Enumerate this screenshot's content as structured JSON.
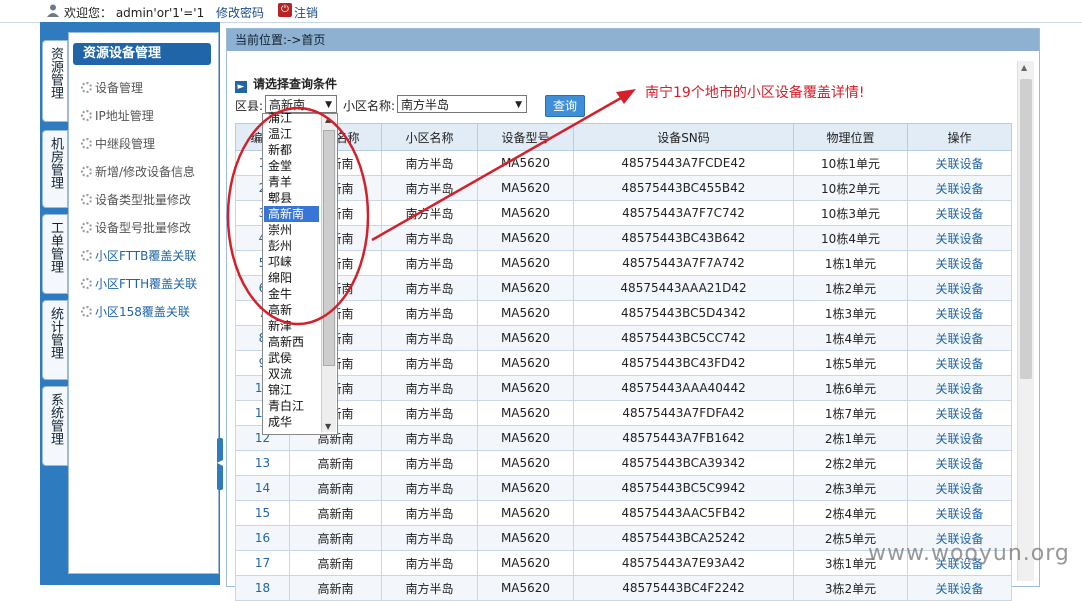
{
  "topbar": {
    "welcome": "欢迎您： admin'or'1'='1",
    "change_password": "修改密码",
    "logout": "注销"
  },
  "vtabs": [
    "资源管理",
    "机房管理",
    "工单管理",
    "统计管理",
    "系统管理"
  ],
  "menu": {
    "title": "资源设备管理",
    "items": [
      "设备管理",
      "IP地址管理",
      "中继段管理",
      "新增/修改设备信息",
      "设备类型批量修改",
      "设备型号批量修改",
      "小区FTTB覆盖关联",
      "小区FTTH覆盖关联",
      "小区158覆盖关联"
    ]
  },
  "breadcrumb": "当前位置:->首页",
  "query": {
    "title": "请选择查询条件",
    "district_label": "区县:",
    "district_value": "高新南",
    "community_label": "小区名称:",
    "community_value": "南方半岛",
    "button": "查询"
  },
  "dropdown_options": [
    "蒲江",
    "温江",
    "新都",
    "金堂",
    "青羊",
    "郫县",
    "高新南",
    "崇州",
    "彭州",
    "邛崃",
    "绵阳",
    "金牛",
    "高新",
    "新津",
    "高新西",
    "武侯",
    "双流",
    "锦江",
    "青白江",
    "成华"
  ],
  "dropdown_selected": "高新南",
  "annotation": "南宁19个地市的小区设备覆盖详情!",
  "table": {
    "headers": [
      "编号",
      "区县名称",
      "小区名称",
      "设备型号",
      "设备SN码",
      "物理位置",
      "操作"
    ],
    "rows": [
      [
        "1",
        "高新南",
        "南方半岛",
        "MA5620",
        "48575443A7FCDE42",
        "10栋1单元",
        "关联设备"
      ],
      [
        "2",
        "高新南",
        "南方半岛",
        "MA5620",
        "48575443BC455B42",
        "10栋2单元",
        "关联设备"
      ],
      [
        "3",
        "高新南",
        "南方半岛",
        "MA5620",
        "48575443A7F7C742",
        "10栋3单元",
        "关联设备"
      ],
      [
        "4",
        "高新南",
        "南方半岛",
        "MA5620",
        "48575443BC43B642",
        "10栋4单元",
        "关联设备"
      ],
      [
        "5",
        "高新南",
        "南方半岛",
        "MA5620",
        "48575443A7F7A742",
        "1栋1单元",
        "关联设备"
      ],
      [
        "6",
        "高新南",
        "南方半岛",
        "MA5620",
        "48575443AAA21D42",
        "1栋2单元",
        "关联设备"
      ],
      [
        "7",
        "高新南",
        "南方半岛",
        "MA5620",
        "48575443BC5D4342",
        "1栋3单元",
        "关联设备"
      ],
      [
        "8",
        "高新南",
        "南方半岛",
        "MA5620",
        "48575443BC5CC742",
        "1栋4单元",
        "关联设备"
      ],
      [
        "9",
        "高新南",
        "南方半岛",
        "MA5620",
        "48575443BC43FD42",
        "1栋5单元",
        "关联设备"
      ],
      [
        "10",
        "高新南",
        "南方半岛",
        "MA5620",
        "48575443AAA40442",
        "1栋6单元",
        "关联设备"
      ],
      [
        "11",
        "高新南",
        "南方半岛",
        "MA5620",
        "48575443A7FDFA42",
        "1栋7单元",
        "关联设备"
      ],
      [
        "12",
        "高新南",
        "南方半岛",
        "MA5620",
        "48575443A7FB1642",
        "2栋1单元",
        "关联设备"
      ],
      [
        "13",
        "高新南",
        "南方半岛",
        "MA5620",
        "48575443BCA39342",
        "2栋2单元",
        "关联设备"
      ],
      [
        "14",
        "高新南",
        "南方半岛",
        "MA5620",
        "48575443BC5C9942",
        "2栋3单元",
        "关联设备"
      ],
      [
        "15",
        "高新南",
        "南方半岛",
        "MA5620",
        "48575443AAC5FB42",
        "2栋4单元",
        "关联设备"
      ],
      [
        "16",
        "高新南",
        "南方半岛",
        "MA5620",
        "48575443BCA25242",
        "2栋5单元",
        "关联设备"
      ],
      [
        "17",
        "高新南",
        "南方半岛",
        "MA5620",
        "48575443A7E93A42",
        "3栋1单元",
        "关联设备"
      ],
      [
        "18",
        "高新南",
        "南方半岛",
        "MA5620",
        "48575443BC4F2242",
        "3栋2单元",
        "关联设备"
      ]
    ]
  },
  "watermark": "www.wooyun.org",
  "colors": {
    "accent": "#1f65a8",
    "annotation": "#d4202a",
    "selection": "#3875d7"
  }
}
